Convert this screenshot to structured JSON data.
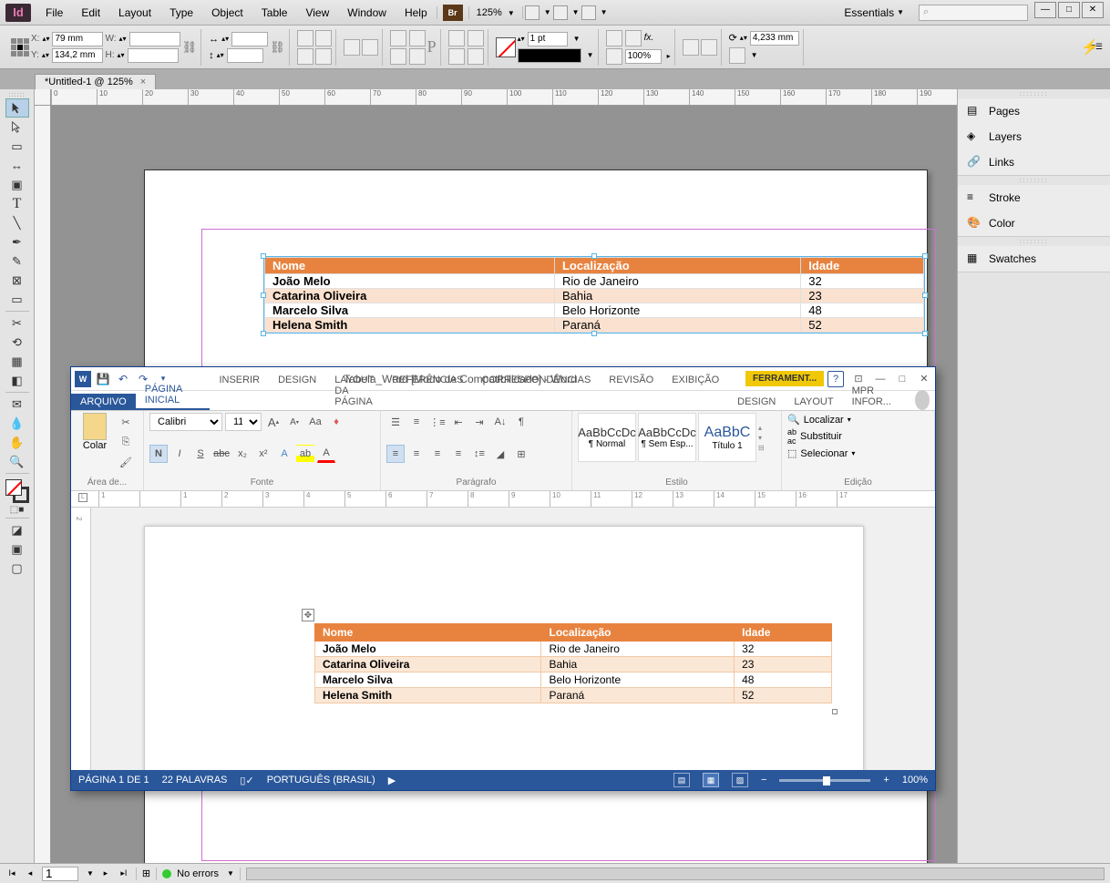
{
  "indesign": {
    "menus": [
      "File",
      "Edit",
      "Layout",
      "Type",
      "Object",
      "Table",
      "View",
      "Window",
      "Help"
    ],
    "zoom": "125%",
    "workspace": "Essentials",
    "search_placeholder": "",
    "control": {
      "x": "79 mm",
      "y": "134,2 mm",
      "w": "",
      "h": "",
      "stroke_weight": "1 pt",
      "opacity": "100%",
      "rotate_w": "4,233 mm"
    },
    "doc_tab": "*Untitled-1 @ 125%",
    "ruler_h": [
      "0",
      "10",
      "20",
      "30",
      "40",
      "50",
      "60",
      "70",
      "80",
      "90",
      "100",
      "110",
      "120",
      "130",
      "140",
      "150",
      "160",
      "170",
      "180",
      "190"
    ],
    "panels": {
      "g1": [
        "Pages",
        "Layers",
        "Links"
      ],
      "g2": [
        "Stroke",
        "Color"
      ],
      "g3": [
        "Swatches"
      ]
    },
    "table": {
      "headers": [
        "Nome",
        "Localização",
        "Idade"
      ],
      "rows": [
        [
          "João Melo",
          "Rio de Janeiro",
          "32"
        ],
        [
          "Catarina Oliveira",
          "Bahia",
          "23"
        ],
        [
          "Marcelo Silva",
          "Belo Horizonte",
          "48"
        ],
        [
          "Helena Smith",
          "Paraná",
          "52"
        ]
      ]
    },
    "status": {
      "page": "1",
      "errors": "No errors"
    }
  },
  "word": {
    "title": "Tabela_Word [Modo de Compatibilidade] - Word",
    "tool_tab": "FERRAMENT...",
    "tabs": {
      "file": "ARQUIVO",
      "home": "PÁGINA INICIAL",
      "others": [
        "INSERIR",
        "DESIGN",
        "LAYOUT DA PÁGINA",
        "REFERÊNCIAS",
        "CORRESPONDÊNCIAS",
        "REVISÃO",
        "EXIBIÇÃO"
      ],
      "contextual": [
        "DESIGN",
        "LAYOUT"
      ],
      "user": "MPR Infor..."
    },
    "ribbon": {
      "clipboard": {
        "paste": "Colar",
        "label": "Área de..."
      },
      "font": {
        "name": "Calibri",
        "size": "11",
        "label": "Fonte"
      },
      "paragraph": {
        "label": "Parágrafo"
      },
      "styles": {
        "s1": "¶ Normal",
        "s2": "¶ Sem Esp...",
        "s3": "Título 1",
        "label": "Estilo",
        "preview": "AaBbCcDc",
        "preview2": "AaBbCcDc",
        "preview3": "AaBbC"
      },
      "editing": {
        "find": "Localizar",
        "replace": "Substituir",
        "select": "Selecionar",
        "label": "Edição"
      }
    },
    "ruler": [
      "1",
      "",
      "1",
      "2",
      "3",
      "4",
      "5",
      "6",
      "7",
      "8",
      "9",
      "10",
      "11",
      "12",
      "13",
      "14",
      "15",
      "16",
      "17"
    ],
    "table": {
      "headers": [
        "Nome",
        "Localização",
        "Idade"
      ],
      "rows": [
        [
          "João Melo",
          "Rio de Janeiro",
          "32"
        ],
        [
          "Catarina Oliveira",
          "Bahia",
          "23"
        ],
        [
          "Marcelo Silva",
          "Belo Horizonte",
          "48"
        ],
        [
          "Helena Smith",
          "Paraná",
          "52"
        ]
      ]
    },
    "status": {
      "page": "PÁGINA 1 DE 1",
      "words": "22 PALAVRAS",
      "lang": "PORTUGUÊS (BRASIL)",
      "zoom": "100%"
    }
  }
}
